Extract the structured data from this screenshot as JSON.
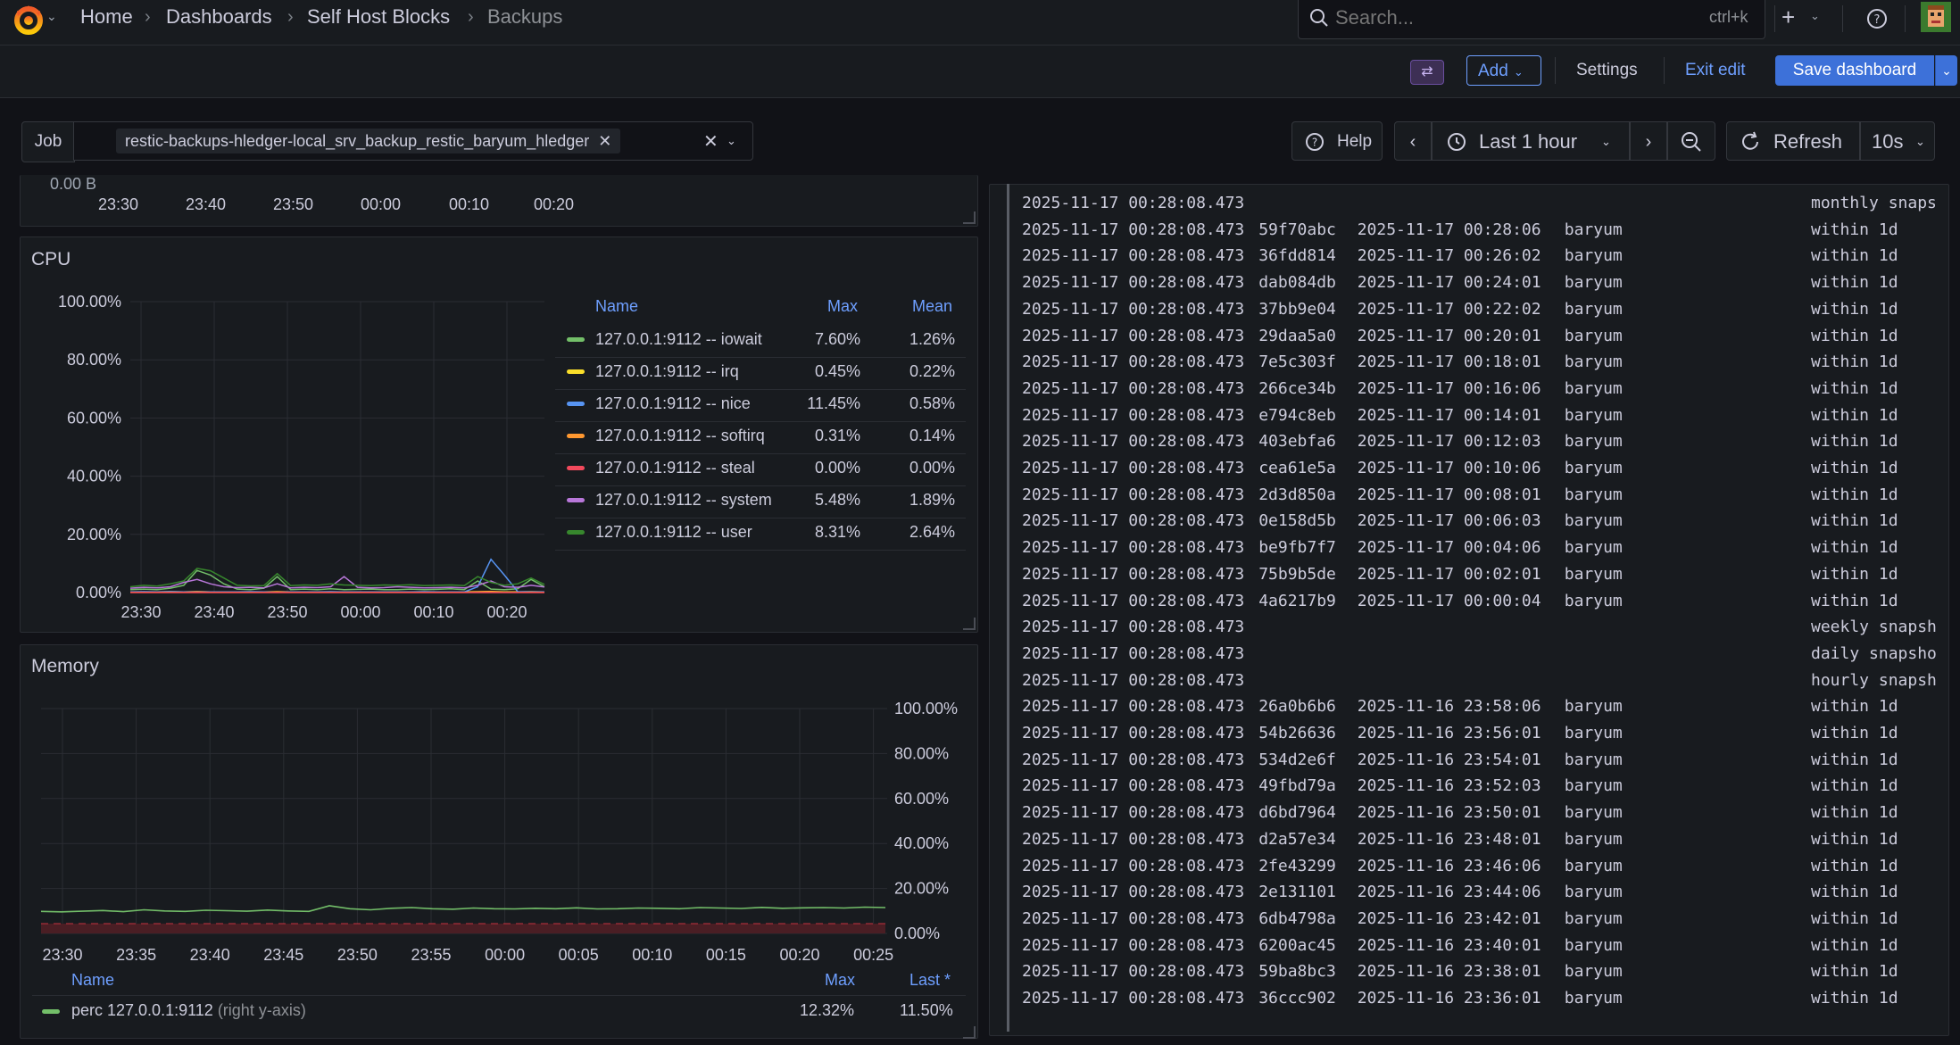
{
  "nav": {
    "breadcrumbs": [
      "Home",
      "Dashboards",
      "Self Host Blocks",
      "Backups"
    ],
    "search_placeholder": "Search...",
    "search_shortcut": "ctrl+k",
    "plus": "+"
  },
  "toolbar": {
    "add": "Add",
    "settings": "Settings",
    "exit_edit": "Exit edit",
    "save": "Save dashboard"
  },
  "variables": {
    "job_label": "Job",
    "job_value": "restic-backups-hledger-local_srv_backup_restic_baryum_hledger"
  },
  "timepicker": {
    "help": "Help",
    "range": "Last 1 hour",
    "refresh": "Refresh",
    "interval": "10s"
  },
  "top_partial_panel": {
    "y_tick": "0.00 B",
    "x_ticks": [
      "23:30",
      "23:40",
      "23:50",
      "00:00",
      "00:10",
      "00:20"
    ]
  },
  "cpu_panel": {
    "title": "CPU",
    "legend_headers": {
      "name": "Name",
      "max": "Max",
      "mean": "Mean"
    },
    "legend": [
      {
        "name": "127.0.0.1:9112 -- iowait",
        "max": "7.60%",
        "mean": "1.26%",
        "color": "#73bf69"
      },
      {
        "name": "127.0.0.1:9112 -- irq",
        "max": "0.45%",
        "mean": "0.22%",
        "color": "#fade2a"
      },
      {
        "name": "127.0.0.1:9112 -- nice",
        "max": "11.45%",
        "mean": "0.58%",
        "color": "#5794f2"
      },
      {
        "name": "127.0.0.1:9112 -- softirq",
        "max": "0.31%",
        "mean": "0.14%",
        "color": "#ff9830"
      },
      {
        "name": "127.0.0.1:9112 -- steal",
        "max": "0.00%",
        "mean": "0.00%",
        "color": "#f2495c"
      },
      {
        "name": "127.0.0.1:9112 -- system",
        "max": "5.48%",
        "mean": "1.89%",
        "color": "#b877d9"
      },
      {
        "name": "127.0.0.1:9112 -- user",
        "max": "8.31%",
        "mean": "2.64%",
        "color": "#37872d"
      }
    ],
    "chart_data": {
      "type": "line",
      "ylim": [
        0,
        100
      ],
      "y_ticks": [
        "100.00%",
        "80.00%",
        "60.00%",
        "40.00%",
        "20.00%",
        "0.00%"
      ],
      "x_ticks": [
        "23:30",
        "23:40",
        "23:50",
        "00:00",
        "00:10",
        "00:20"
      ],
      "series": [
        {
          "name": "127.0.0.1:9112 -- iowait",
          "values": [
            1.0,
            1.2,
            1.0,
            1.5,
            2.5,
            7.6,
            6.0,
            3.0,
            1.2,
            1.0,
            1.5,
            5.5,
            1.0,
            1.2,
            1.0,
            1.3,
            1.0,
            1.1,
            1.2,
            1.0,
            1.0,
            1.2,
            1.0,
            1.1,
            1.3,
            1.0,
            4.0,
            1.2,
            1.0,
            1.3,
            4.5,
            2.0
          ]
        },
        {
          "name": "127.0.0.1:9112 -- irq",
          "values": [
            0.2,
            0.2,
            0.2,
            0.3,
            0.2,
            0.3,
            0.2,
            0.2,
            0.2,
            0.2,
            0.2,
            0.3,
            0.2,
            0.2,
            0.2,
            0.2,
            0.2,
            0.2,
            0.2,
            0.2,
            0.2,
            0.2,
            0.2,
            0.2,
            0.2,
            0.2,
            0.3,
            0.4,
            0.2,
            0.2,
            0.3,
            0.2
          ]
        },
        {
          "name": "127.0.0.1:9112 -- nice",
          "values": [
            0.2,
            0.3,
            0.2,
            0.3,
            0.2,
            0.3,
            0.2,
            0.2,
            0.2,
            0.3,
            0.2,
            0.2,
            0.2,
            0.2,
            0.2,
            0.3,
            0.2,
            0.2,
            0.2,
            0.2,
            0.2,
            0.2,
            0.3,
            0.2,
            0.2,
            0.2,
            2.0,
            11.45,
            6.0,
            0.3,
            0.2,
            0.2
          ]
        },
        {
          "name": "127.0.0.1:9112 -- softirq",
          "values": [
            0.1,
            0.1,
            0.1,
            0.1,
            0.1,
            0.2,
            0.1,
            0.1,
            0.1,
            0.1,
            0.1,
            0.2,
            0.1,
            0.1,
            0.1,
            0.1,
            0.1,
            0.1,
            0.1,
            0.1,
            0.1,
            0.1,
            0.1,
            0.1,
            0.1,
            0.1,
            0.2,
            0.3,
            0.1,
            0.1,
            0.1,
            0.1
          ]
        },
        {
          "name": "127.0.0.1:9112 -- steal",
          "values": [
            0,
            0,
            0,
            0,
            0,
            0,
            0,
            0,
            0,
            0,
            0,
            0,
            0,
            0,
            0,
            0,
            0,
            0,
            0,
            0,
            0,
            0,
            0,
            0,
            0,
            0,
            0,
            0,
            0,
            0,
            0,
            0
          ]
        },
        {
          "name": "127.0.0.1:9112 -- system",
          "values": [
            1.5,
            1.8,
            1.6,
            2.0,
            3.5,
            4.5,
            3.0,
            2.0,
            1.7,
            1.8,
            1.6,
            3.0,
            1.6,
            1.8,
            1.7,
            2.0,
            5.48,
            1.8,
            1.6,
            1.7,
            2.0,
            1.8,
            1.6,
            1.7,
            1.8,
            1.6,
            2.5,
            4.0,
            2.0,
            1.8,
            2.5,
            1.9
          ]
        },
        {
          "name": "127.0.0.1:9112 -- user",
          "values": [
            2.0,
            2.5,
            2.2,
            3.0,
            4.0,
            8.31,
            7.5,
            5.0,
            2.5,
            2.3,
            2.4,
            6.5,
            2.4,
            2.6,
            2.5,
            3.0,
            2.6,
            2.5,
            2.4,
            2.6,
            2.5,
            2.7,
            2.4,
            2.5,
            2.6,
            2.4,
            5.5,
            3.5,
            2.5,
            3.0,
            5.0,
            2.8
          ]
        }
      ]
    }
  },
  "memory_panel": {
    "title": "Memory",
    "legend_headers": {
      "name": "Name",
      "max": "Max",
      "last": "Last *"
    },
    "legend": [
      {
        "name": "perc 127.0.0.1:9112",
        "suffix": "(right y-axis)",
        "max": "12.32%",
        "last": "11.50%",
        "color": "#73bf69"
      }
    ],
    "chart_data": {
      "type": "line",
      "ylim": [
        0,
        100
      ],
      "y_ticks": [
        "100.00%",
        "80.00%",
        "60.00%",
        "40.00%",
        "20.00%",
        "0.00%"
      ],
      "x_ticks": [
        "23:30",
        "23:35",
        "23:40",
        "23:45",
        "23:50",
        "23:55",
        "00:00",
        "00:05",
        "00:10",
        "00:15",
        "00:20",
        "00:25"
      ],
      "series": [
        {
          "name": "perc 127.0.0.1:9112",
          "values": [
            9.8,
            9.6,
            9.9,
            10.2,
            9.7,
            10.5,
            10.0,
            9.8,
            10.3,
            10.1,
            9.9,
            10.4,
            10.0,
            9.8,
            12.32,
            11.0,
            10.5,
            11.2,
            11.5,
            11.0,
            10.8,
            11.3,
            11.0,
            10.9,
            11.2,
            11.0,
            11.4,
            10.9,
            11.0,
            11.3,
            11.2,
            11.0,
            11.5,
            11.3,
            11.1,
            11.6,
            11.2,
            11.4,
            11.5,
            11.3,
            11.7,
            11.5
          ]
        }
      ],
      "thresholds_band": [
        0,
        2
      ]
    }
  },
  "logs": {
    "lines": [
      {
        "ts": "2025-11-17 00:28:08.473",
        "id": "",
        "snap": "",
        "host": "",
        "tag": "monthly snapshots"
      },
      {
        "ts": "2025-11-17 00:28:08.473",
        "id": "59f70abc",
        "snap": "2025-11-17 00:28:06",
        "host": "baryum",
        "tag": "within 1d"
      },
      {
        "ts": "2025-11-17 00:28:08.473",
        "id": "36fdd814",
        "snap": "2025-11-17 00:26:02",
        "host": "baryum",
        "tag": "within 1d"
      },
      {
        "ts": "2025-11-17 00:28:08.473",
        "id": "dab084db",
        "snap": "2025-11-17 00:24:01",
        "host": "baryum",
        "tag": "within 1d"
      },
      {
        "ts": "2025-11-17 00:28:08.473",
        "id": "37bb9e04",
        "snap": "2025-11-17 00:22:02",
        "host": "baryum",
        "tag": "within 1d"
      },
      {
        "ts": "2025-11-17 00:28:08.473",
        "id": "29daa5a0",
        "snap": "2025-11-17 00:20:01",
        "host": "baryum",
        "tag": "within 1d"
      },
      {
        "ts": "2025-11-17 00:28:08.473",
        "id": "7e5c303f",
        "snap": "2025-11-17 00:18:01",
        "host": "baryum",
        "tag": "within 1d"
      },
      {
        "ts": "2025-11-17 00:28:08.473",
        "id": "266ce34b",
        "snap": "2025-11-17 00:16:06",
        "host": "baryum",
        "tag": "within 1d"
      },
      {
        "ts": "2025-11-17 00:28:08.473",
        "id": "e794c8eb",
        "snap": "2025-11-17 00:14:01",
        "host": "baryum",
        "tag": "within 1d"
      },
      {
        "ts": "2025-11-17 00:28:08.473",
        "id": "403ebfa6",
        "snap": "2025-11-17 00:12:03",
        "host": "baryum",
        "tag": "within 1d"
      },
      {
        "ts": "2025-11-17 00:28:08.473",
        "id": "cea61e5a",
        "snap": "2025-11-17 00:10:06",
        "host": "baryum",
        "tag": "within 1d"
      },
      {
        "ts": "2025-11-17 00:28:08.473",
        "id": "2d3d850a",
        "snap": "2025-11-17 00:08:01",
        "host": "baryum",
        "tag": "within 1d"
      },
      {
        "ts": "2025-11-17 00:28:08.473",
        "id": "0e158d5b",
        "snap": "2025-11-17 00:06:03",
        "host": "baryum",
        "tag": "within 1d"
      },
      {
        "ts": "2025-11-17 00:28:08.473",
        "id": "be9fb7f7",
        "snap": "2025-11-17 00:04:06",
        "host": "baryum",
        "tag": "within 1d"
      },
      {
        "ts": "2025-11-17 00:28:08.473",
        "id": "75b9b5de",
        "snap": "2025-11-17 00:02:01",
        "host": "baryum",
        "tag": "within 1d"
      },
      {
        "ts": "2025-11-17 00:28:08.473",
        "id": "4a6217b9",
        "snap": "2025-11-17 00:00:04",
        "host": "baryum",
        "tag": "within 1d"
      },
      {
        "ts": "2025-11-17 00:28:08.473",
        "id": "",
        "snap": "",
        "host": "",
        "tag": "weekly snapshots"
      },
      {
        "ts": "2025-11-17 00:28:08.473",
        "id": "",
        "snap": "",
        "host": "",
        "tag": "daily snapshots"
      },
      {
        "ts": "2025-11-17 00:28:08.473",
        "id": "",
        "snap": "",
        "host": "",
        "tag": "hourly snapshots"
      },
      {
        "ts": "2025-11-17 00:28:08.473",
        "id": "26a0b6b6",
        "snap": "2025-11-16 23:58:06",
        "host": "baryum",
        "tag": "within 1d"
      },
      {
        "ts": "2025-11-17 00:28:08.473",
        "id": "54b26636",
        "snap": "2025-11-16 23:56:01",
        "host": "baryum",
        "tag": "within 1d"
      },
      {
        "ts": "2025-11-17 00:28:08.473",
        "id": "534d2e6f",
        "snap": "2025-11-16 23:54:01",
        "host": "baryum",
        "tag": "within 1d"
      },
      {
        "ts": "2025-11-17 00:28:08.473",
        "id": "49fbd79a",
        "snap": "2025-11-16 23:52:03",
        "host": "baryum",
        "tag": "within 1d"
      },
      {
        "ts": "2025-11-17 00:28:08.473",
        "id": "d6bd7964",
        "snap": "2025-11-16 23:50:01",
        "host": "baryum",
        "tag": "within 1d"
      },
      {
        "ts": "2025-11-17 00:28:08.473",
        "id": "d2a57e34",
        "snap": "2025-11-16 23:48:01",
        "host": "baryum",
        "tag": "within 1d"
      },
      {
        "ts": "2025-11-17 00:28:08.473",
        "id": "2fe43299",
        "snap": "2025-11-16 23:46:06",
        "host": "baryum",
        "tag": "within 1d"
      },
      {
        "ts": "2025-11-17 00:28:08.473",
        "id": "2e131101",
        "snap": "2025-11-16 23:44:06",
        "host": "baryum",
        "tag": "within 1d"
      },
      {
        "ts": "2025-11-17 00:28:08.473",
        "id": "6db4798a",
        "snap": "2025-11-16 23:42:01",
        "host": "baryum",
        "tag": "within 1d"
      },
      {
        "ts": "2025-11-17 00:28:08.473",
        "id": "6200ac45",
        "snap": "2025-11-16 23:40:01",
        "host": "baryum",
        "tag": "within 1d"
      },
      {
        "ts": "2025-11-17 00:28:08.473",
        "id": "59ba8bc3",
        "snap": "2025-11-16 23:38:01",
        "host": "baryum",
        "tag": "within 1d"
      },
      {
        "ts": "2025-11-17 00:28:08.473",
        "id": "36ccc902",
        "snap": "2025-11-16 23:36:01",
        "host": "baryum",
        "tag": "within 1d"
      }
    ]
  }
}
